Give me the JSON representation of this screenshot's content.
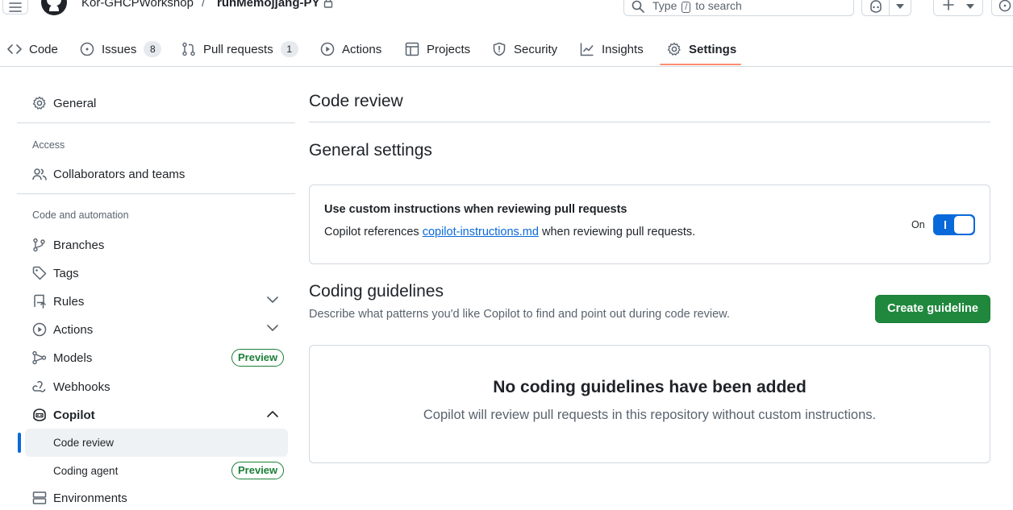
{
  "header": {
    "owner": "Kor-GHCPWorkshop",
    "separator": "/",
    "repo": "runMemojjang-PY",
    "search_before": "Type",
    "search_key": "/",
    "search_after": "to search"
  },
  "tabs": [
    {
      "label": "Code",
      "icon": "code-icon"
    },
    {
      "label": "Issues",
      "icon": "issue-opened-icon",
      "count": "8"
    },
    {
      "label": "Pull requests",
      "icon": "git-pull-request-icon",
      "count": "1"
    },
    {
      "label": "Actions",
      "icon": "play-icon"
    },
    {
      "label": "Projects",
      "icon": "table-icon"
    },
    {
      "label": "Security",
      "icon": "shield-icon"
    },
    {
      "label": "Insights",
      "icon": "graph-icon"
    },
    {
      "label": "Settings",
      "icon": "gear-icon",
      "selected": true
    }
  ],
  "sidebar": {
    "general": "General",
    "access_heading": "Access",
    "collaborators": "Collaborators and teams",
    "code_automation_heading": "Code and automation",
    "branches": "Branches",
    "tags": "Tags",
    "rules": "Rules",
    "actions": "Actions",
    "models": "Models",
    "models_badge": "Preview",
    "webhooks": "Webhooks",
    "copilot": "Copilot",
    "code_review": "Code review",
    "coding_agent": "Coding agent",
    "coding_agent_badge": "Preview",
    "environments": "Environments"
  },
  "main": {
    "title": "Code review",
    "general_settings": "General settings",
    "custom_instructions": {
      "title": "Use custom instructions when reviewing pull requests",
      "desc_before": "Copilot references",
      "link": "copilot-instructions.md",
      "desc_after": "when reviewing pull requests.",
      "toggle_label": "On",
      "toggle_on": true
    },
    "coding_guidelines": {
      "title": "Coding guidelines",
      "desc": "Describe what patterns you'd like Copilot to find and point out during code review.",
      "create_button": "Create guideline",
      "empty_title": "No coding guidelines have been added",
      "empty_desc": "Copilot will review pull requests in this repository without custom instructions."
    }
  },
  "colors": {
    "accent": "#0969da",
    "tab_underline": "#fd8c73",
    "primary_button": "#1f883d",
    "preview_badge": "#1a7f37",
    "border": "#d1d9e0"
  }
}
